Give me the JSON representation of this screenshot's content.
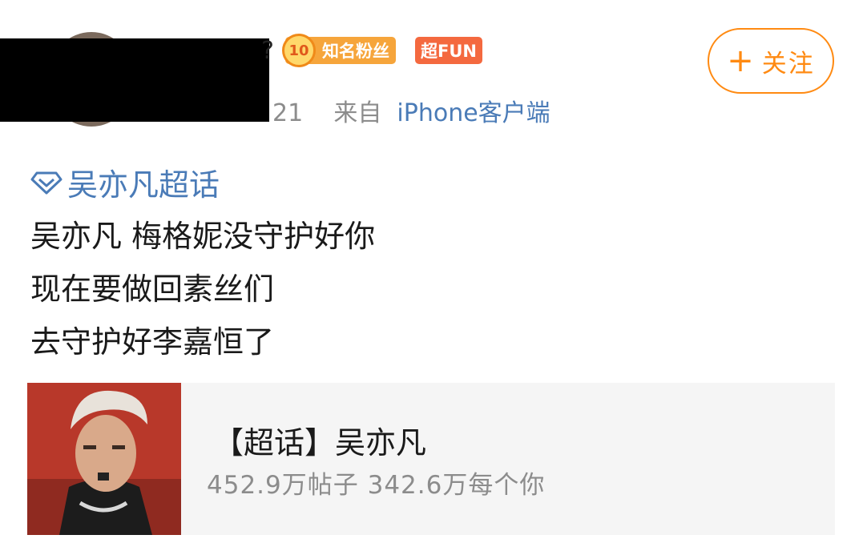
{
  "header": {
    "name_tail": "?",
    "fan_badge": {
      "level": "10",
      "label": "知名粉丝"
    },
    "super_badge": "超FUN",
    "follow_label": "关注",
    "time_tail": "21",
    "source_prefix": "来自",
    "source": "iPhone客户端"
  },
  "post": {
    "topic": "吴亦凡超话",
    "lines": [
      "吴亦凡 梅格妮没守护好你",
      "现在要做回素丝们",
      "去守护好李嘉恒了"
    ]
  },
  "card": {
    "title": "【超话】吴亦凡",
    "subtitle": "452.9万帖子 342.6万每个你"
  },
  "colors": {
    "accent_orange": "#ff8a12",
    "link_blue": "#4a7bb7",
    "badge_orange": "#f6a53b",
    "badge_red": "#f4693f"
  },
  "icons": [
    "plus-icon",
    "diamond-icon"
  ]
}
